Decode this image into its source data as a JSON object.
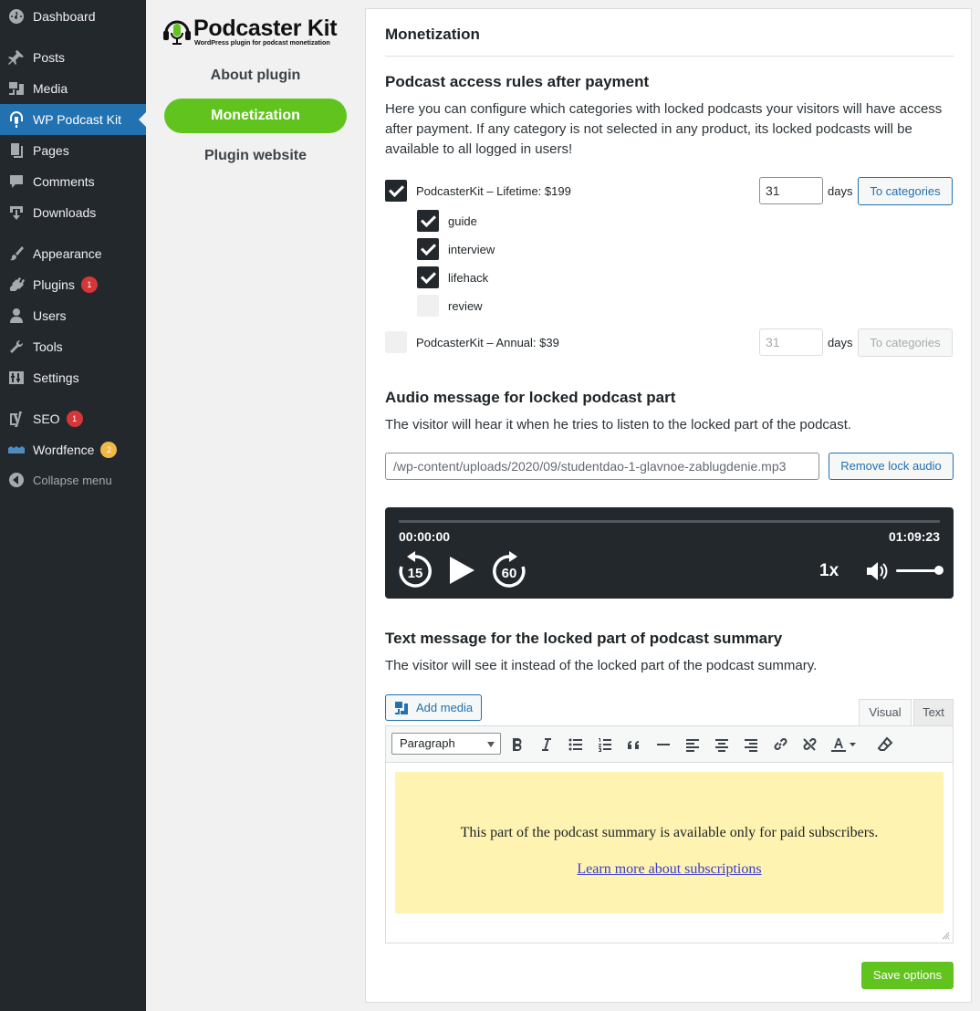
{
  "sidebar": {
    "items": [
      {
        "label": "Dashboard",
        "icon": "dashboard-icon"
      },
      {
        "label": "Posts",
        "icon": "pin-icon"
      },
      {
        "label": "Media",
        "icon": "media-icon"
      },
      {
        "label": "WP Podcast Kit",
        "icon": "podcast-icon",
        "current": true
      },
      {
        "label": "Pages",
        "icon": "pages-icon"
      },
      {
        "label": "Comments",
        "icon": "comment-icon"
      },
      {
        "label": "Downloads",
        "icon": "download-icon"
      },
      {
        "label": "Appearance",
        "icon": "brush-icon"
      },
      {
        "label": "Plugins",
        "icon": "plug-icon",
        "badge": "1"
      },
      {
        "label": "Users",
        "icon": "user-icon"
      },
      {
        "label": "Tools",
        "icon": "wrench-icon"
      },
      {
        "label": "Settings",
        "icon": "sliders-icon"
      },
      {
        "label": "SEO",
        "icon": "yoast-icon",
        "badge": "1"
      },
      {
        "label": "Wordfence",
        "icon": "wordfence-icon",
        "badge": "2"
      },
      {
        "label": "Collapse menu",
        "icon": "collapse-icon"
      }
    ]
  },
  "plugin": {
    "logo_title": "Podcaster Kit",
    "logo_subtitle": "WordPress plugin for podcast monetization",
    "nav": [
      "About plugin",
      "Monetization",
      "Plugin website"
    ],
    "active_nav": "Monetization"
  },
  "main": {
    "title": "Monetization",
    "access": {
      "heading": "Podcast access rules after payment",
      "description": "Here you can configure which categories with locked podcasts your visitors will have access after payment. If any category is not selected in any product, its locked podcasts will be available to all logged in users!",
      "products": [
        {
          "label": "PodcasterKit – Lifetime: $199",
          "checked": true,
          "days": "31",
          "days_label": "days",
          "button": "To categories",
          "enabled": true,
          "categories": [
            {
              "label": "guide",
              "checked": true
            },
            {
              "label": "interview",
              "checked": true
            },
            {
              "label": "lifehack",
              "checked": true
            },
            {
              "label": "review",
              "checked": false
            }
          ]
        },
        {
          "label": "PodcasterKit – Annual: $39",
          "checked": false,
          "days": "31",
          "days_label": "days",
          "button": "To categories",
          "enabled": false
        }
      ]
    },
    "audio": {
      "heading": "Audio message for locked podcast part",
      "description": "The visitor will hear it when he tries to listen to the locked part of the podcast.",
      "file_url": "/wp-content/uploads/2020/09/studentdao-1-glavnoe-zablugdenie.mp3",
      "remove_button": "Remove lock audio",
      "player": {
        "current_time": "00:00:00",
        "duration": "01:09:23",
        "progress": 0,
        "rewind_label": "15",
        "forward_label": "60",
        "speed": "1x",
        "volume": 0.9
      }
    },
    "text_message": {
      "heading": "Text message for the locked part of podcast summary",
      "description": "The visitor will see it instead of the locked part of the podcast summary.",
      "add_media_label": "Add media",
      "tabs": [
        "Visual",
        "Text"
      ],
      "active_tab": "Visual",
      "format_select": "Paragraph",
      "toolbar_icons": [
        "bold-icon",
        "italic-icon",
        "bullet-list-icon",
        "numbered-list-icon",
        "blockquote-icon",
        "horizontal-line-icon",
        "align-left-icon",
        "align-center-icon",
        "align-right-icon",
        "link-icon",
        "unlink-icon",
        "text-color-icon",
        "clear-formatting-icon"
      ],
      "content_text": "This part of the podcast summary is available only for paid subscribers.",
      "content_link": "Learn more about subscriptions",
      "highlight_color": "#fef3b0"
    },
    "save_button": "Save options"
  },
  "colors": {
    "sidebar_bg": "#23282d",
    "accent_blue": "#2271b1",
    "accent_green": "#61c31d",
    "badge_red": "#d63638",
    "badge_orange": "#f0b849"
  }
}
